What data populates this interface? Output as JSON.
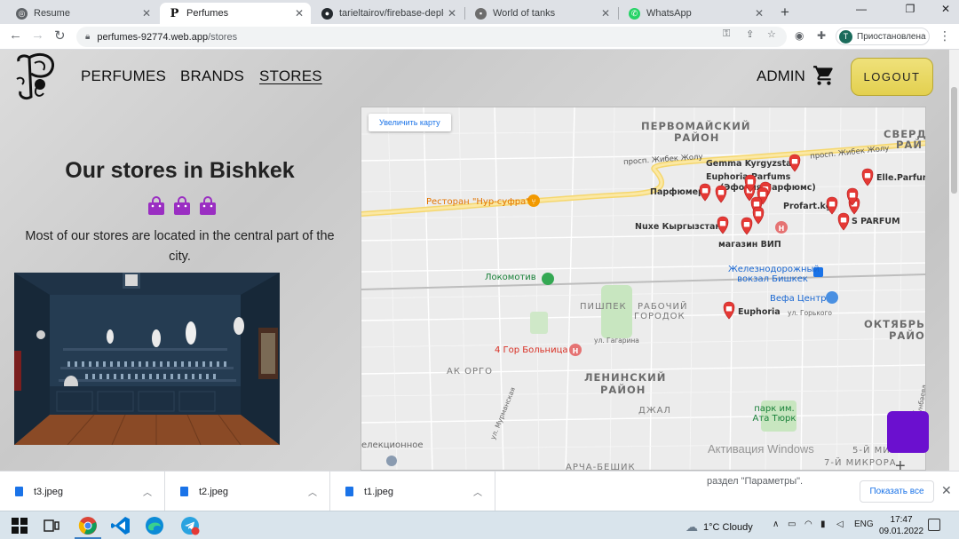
{
  "browser": {
    "tabs": [
      {
        "label": "Resume",
        "icon": "globe-icon"
      },
      {
        "label": "Perfumes",
        "icon": "perfumes-favicon"
      },
      {
        "label": "tarieltairov/firebase-deploy-",
        "icon": "github-icon"
      },
      {
        "label": "World of tanks",
        "icon": "tank-icon"
      },
      {
        "label": "WhatsApp",
        "icon": "whatsapp-icon"
      }
    ],
    "url_domain": "perfumes-92774.web.app",
    "url_path": "/stores",
    "profile_initial": "T",
    "profile_label": "Приостановлена"
  },
  "nav": {
    "links": [
      "PERFUMES",
      "BRANDS",
      "STORES"
    ],
    "active": "STORES",
    "admin_label": "ADMIN",
    "logout_label": "LOGOUT"
  },
  "stores": {
    "title": "Our stores in Bishkek",
    "description": "Most of our stores are located in the central part of the city."
  },
  "map": {
    "enlarge_label": "Увеличить карту",
    "districts": [
      "ПЕРВОМАЙСКИЙ",
      "РАЙОН",
      "СВЕРД",
      "РАЙ",
      "ЛЕНИНСКИЙ",
      "РАЙОН",
      "ОКТЯБРЬ",
      "РАЙО",
      "ПИШПЕК",
      "РАБОЧИЙ",
      "ГОРОДОК",
      "АК ОРГО",
      "ДЖАЛ",
      "АРЧА-БЕШИК",
      "5-Й МИКРОРА",
      "7-Й МИКРОРА"
    ],
    "streets": [
      "просп. Жибек Жолу",
      "просп. Жибек Жолу",
      "ул. Гагарина",
      "ул. Мурманская",
      "ул. Горького",
      "ул. Ахунбаева"
    ],
    "places": [
      {
        "name": "Ресторан \"Нур-суфра\"",
        "kind": "restaurant"
      },
      {
        "name": "Локомотив",
        "kind": "park"
      },
      {
        "name": "4 Гор Больница",
        "kind": "hospital"
      },
      {
        "name": "Железнодорожный вокзал Бишкек",
        "kind": "station"
      },
      {
        "name": "Вефа Центр",
        "kind": "mall"
      },
      {
        "name": "парк им. Ата Тюрк",
        "kind": "park"
      },
      {
        "name": "елекционное",
        "kind": "label"
      }
    ],
    "stores": [
      "Gemma Kyrgyzstan",
      "Euphoria Parfums",
      "(Эфория Парфюмс)",
      "Парфюмер",
      "Elle.Parfum",
      "Profart.kg",
      "S PARFUM",
      "Nuxe Кыргызстан",
      "магазин ВИП",
      "Euphoria"
    ]
  },
  "overlay": {
    "activate_title": "Активация Windows",
    "activate_sub": "раздел \"Параметры\"."
  },
  "downloads": {
    "files": [
      "t3.jpeg",
      "t2.jpeg",
      "t1.jpeg"
    ],
    "show_all_label": "Показать все"
  },
  "taskbar": {
    "weather": "1°C  Cloudy",
    "lang": "ENG",
    "time": "17:47",
    "date": "09.01.2022"
  },
  "colors": {
    "accent_logout": "#e3d04f",
    "store_marker": "#e53935",
    "bag": "#9a2ec2",
    "chat": "#6b10cf"
  }
}
